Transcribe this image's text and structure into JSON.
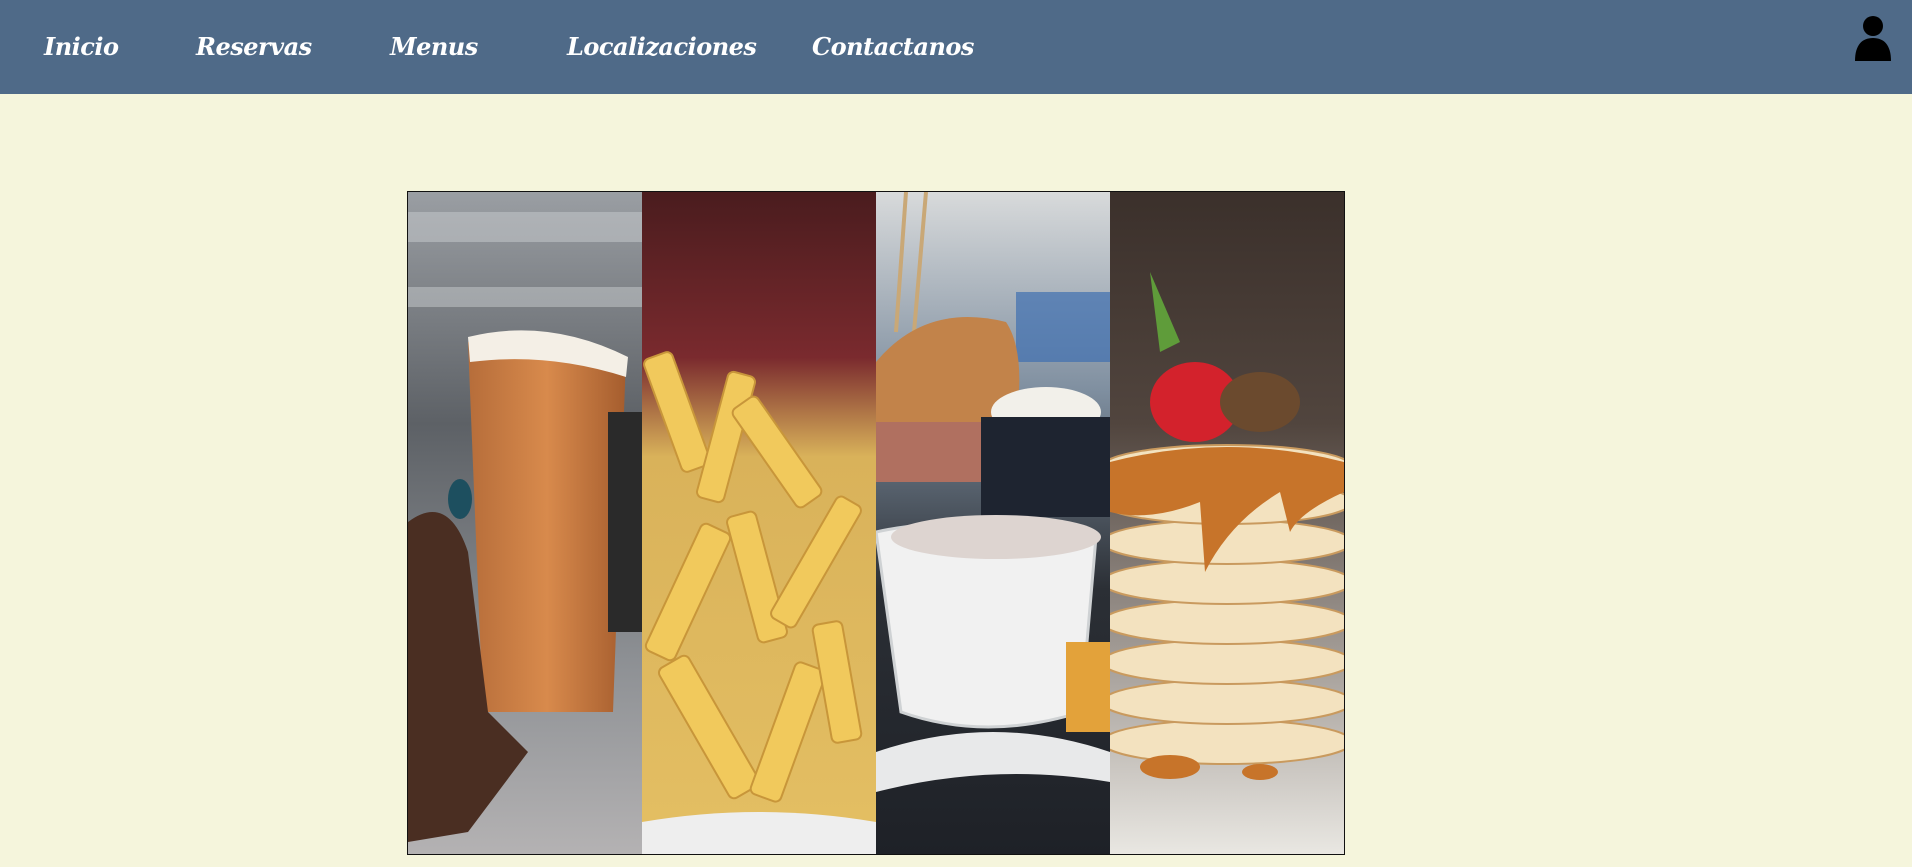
{
  "nav": {
    "items": [
      {
        "label": "Inicio"
      },
      {
        "label": "Reservas"
      },
      {
        "label": "Menus"
      },
      {
        "label": "Localizaciones"
      },
      {
        "label": "Contactanos"
      }
    ]
  },
  "user_icon": "user-icon",
  "gallery": {
    "panels": [
      {
        "subject": "beer"
      },
      {
        "subject": "fries"
      },
      {
        "subject": "burger"
      },
      {
        "subject": "pancakes"
      }
    ]
  },
  "colors": {
    "navbar": "#4f6a88",
    "background": "#f5f5dc",
    "nav_text": "#ffffff"
  }
}
